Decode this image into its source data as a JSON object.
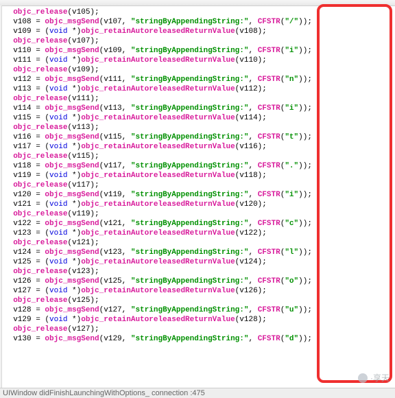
{
  "bottom_status": "UIWindow didFinishLaunchingWithOptions_  connection   :475",
  "watermark": "·享天",
  "fn": {
    "release": "objc_release",
    "msgsend": "objc_msgSend",
    "retain": "objc_retainAutoreleasedReturnValue",
    "cfstr": "CFSTR"
  },
  "str_method": "\"stringByAppendingString:\"",
  "kw_void": "void",
  "lines": [
    {
      "t": "release",
      "arg": "v105"
    },
    {
      "t": "msgsend",
      "lhs": "v108",
      "in": "v107",
      "s": "\"/\""
    },
    {
      "t": "retain",
      "lhs": "v109",
      "in": "v108"
    },
    {
      "t": "release",
      "arg": "v107"
    },
    {
      "t": "msgsend",
      "lhs": "v110",
      "in": "v109",
      "s": "\"i\""
    },
    {
      "t": "retain",
      "lhs": "v111",
      "in": "v110"
    },
    {
      "t": "release",
      "arg": "v109"
    },
    {
      "t": "msgsend",
      "lhs": "v112",
      "in": "v111",
      "s": "\"n\""
    },
    {
      "t": "retain",
      "lhs": "v113",
      "in": "v112"
    },
    {
      "t": "release",
      "arg": "v111"
    },
    {
      "t": "msgsend",
      "lhs": "v114",
      "in": "v113",
      "s": "\"i\""
    },
    {
      "t": "retain",
      "lhs": "v115",
      "in": "v114"
    },
    {
      "t": "release",
      "arg": "v113"
    },
    {
      "t": "msgsend",
      "lhs": "v116",
      "in": "v115",
      "s": "\"t\""
    },
    {
      "t": "retain",
      "lhs": "v117",
      "in": "v116"
    },
    {
      "t": "release",
      "arg": "v115"
    },
    {
      "t": "msgsend",
      "lhs": "v118",
      "in": "v117",
      "s": "\".\""
    },
    {
      "t": "retain",
      "lhs": "v119",
      "in": "v118"
    },
    {
      "t": "release",
      "arg": "v117"
    },
    {
      "t": "msgsend",
      "lhs": "v120",
      "in": "v119",
      "s": "\"i\""
    },
    {
      "t": "retain",
      "lhs": "v121",
      "in": "v120"
    },
    {
      "t": "release",
      "arg": "v119"
    },
    {
      "t": "msgsend",
      "lhs": "v122",
      "in": "v121",
      "s": "\"c\""
    },
    {
      "t": "retain",
      "lhs": "v123",
      "in": "v122"
    },
    {
      "t": "release",
      "arg": "v121"
    },
    {
      "t": "msgsend",
      "lhs": "v124",
      "in": "v123",
      "s": "\"l\""
    },
    {
      "t": "retain",
      "lhs": "v125",
      "in": "v124"
    },
    {
      "t": "release",
      "arg": "v123"
    },
    {
      "t": "msgsend",
      "lhs": "v126",
      "in": "v125",
      "s": "\"o\""
    },
    {
      "t": "retain",
      "lhs": "v127",
      "in": "v126"
    },
    {
      "t": "release",
      "arg": "v125"
    },
    {
      "t": "msgsend",
      "lhs": "v128",
      "in": "v127",
      "s": "\"u\""
    },
    {
      "t": "retain",
      "lhs": "v129",
      "in": "v128"
    },
    {
      "t": "release",
      "arg": "v127"
    },
    {
      "t": "msgsend",
      "lhs": "v130",
      "in": "v129",
      "s": "\"d\""
    }
  ]
}
